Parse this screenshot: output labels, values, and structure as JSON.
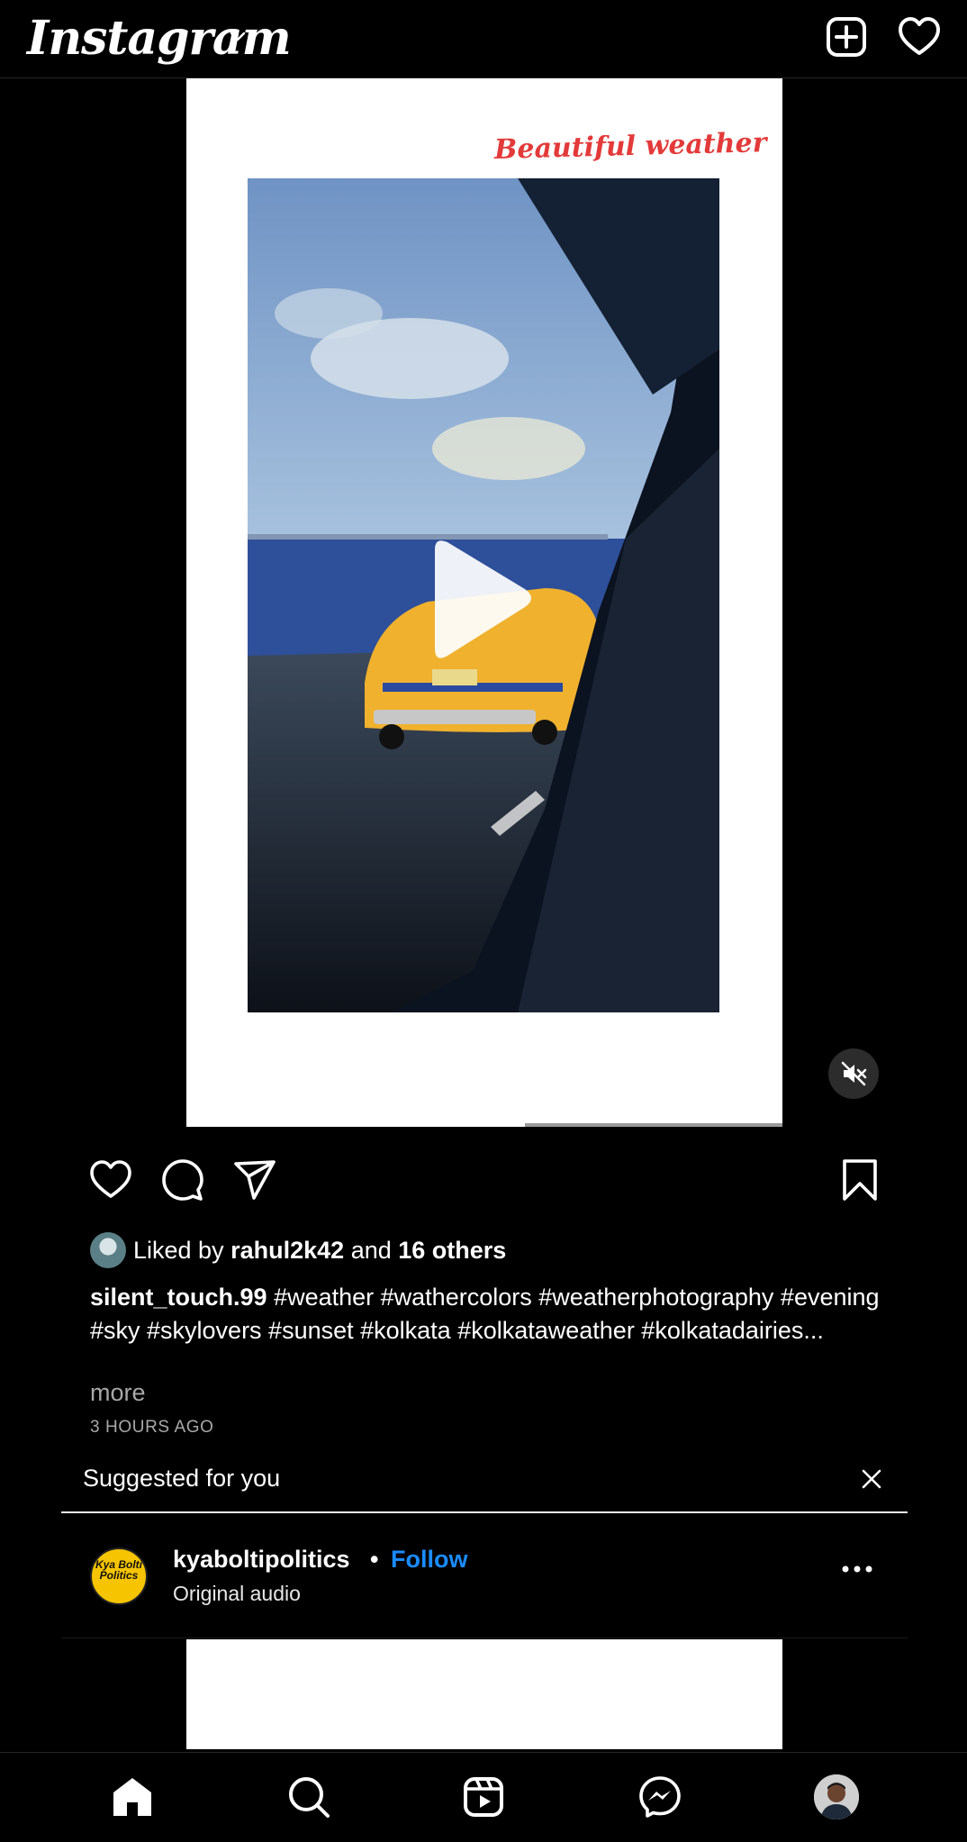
{
  "app": {
    "title": "Instagram"
  },
  "post": {
    "overlay_text": "Beautiful weather",
    "likes": {
      "prefix": "Liked by",
      "user": "rahul2k42",
      "connector": "and",
      "others": "16 others"
    },
    "caption": {
      "username": "silent_touch.99",
      "text": "#weather #wathercolors #weatherphotography #evening #sky #skylovers #sunset #kolkata #kolkataweather #kolkatadairies...",
      "more": "more"
    },
    "time": "3 HOURS AGO"
  },
  "suggested": {
    "title": "Suggested for you",
    "post": {
      "avatar_text": "Kya Bolti Politics",
      "username": "kyaboltipolitics",
      "separator": "•",
      "follow": "Follow",
      "audio": "Original audio"
    }
  },
  "icons": {
    "top": [
      "chevron-down-icon",
      "new-post-icon",
      "heart-icon"
    ],
    "actions": [
      "like-icon",
      "comment-icon",
      "share-icon",
      "bookmark-icon"
    ],
    "nav": [
      "home-icon",
      "search-icon",
      "reels-icon",
      "messenger-icon",
      "profile-icon"
    ]
  },
  "colors": {
    "background": "#000000",
    "link": "#1a8cff",
    "overlay_text": "#e33a3a",
    "secondary_text": "#a8a8a8"
  }
}
